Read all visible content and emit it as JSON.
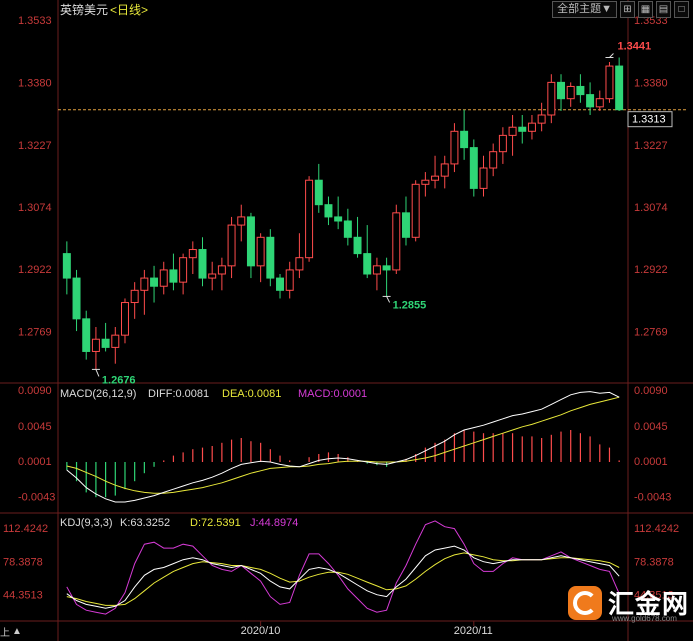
{
  "header": {
    "symbol": "英镑美元",
    "period": "<日线>"
  },
  "toolbar": {
    "theme_label": "全部主题▼",
    "icons": [
      "grid-icon",
      "chart-icon",
      "double-window-icon",
      "single-window-icon"
    ]
  },
  "price_panel": {
    "high_label": "1.3441",
    "low_label": "1.2676",
    "mid_low_label": "1.2855",
    "current_price": "1.3313",
    "price_ticks": [
      "1.3533",
      "1.3380",
      "1.3227",
      "1.3074",
      "1.2922",
      "1.2769"
    ]
  },
  "macd_panel": {
    "title": "MACD(26,12,9)",
    "diff_label": "DIFF:0.0081",
    "dea_label": "DEA:0.0081",
    "macd_label": "MACD:0.0001",
    "ticks": [
      "0.0090",
      "0.0045",
      "0.0001",
      "-0.0043"
    ]
  },
  "kdj_panel": {
    "title": "KDJ(9,3,3)",
    "k_label": "K:63.3252",
    "d_label": "D:72.5391",
    "j_label": "J:44.8974",
    "ticks": [
      "112.4242",
      "78.3878",
      "44.3513"
    ]
  },
  "date_labels": [
    "2020/10",
    "2020/11"
  ],
  "footer": {
    "logo_text": "汇金网",
    "logo_url": "www.gold678.com",
    "pager": "上"
  },
  "colors": {
    "up": "#ff4c4c",
    "down": "#2fd576",
    "axis": "#c83a3a",
    "diff": "#ffffff",
    "dea": "#e8e83a",
    "j_line": "#d63bd6",
    "current_line": "#e0a040"
  },
  "chart_data": {
    "type": "candlestick",
    "price_axis": {
      "min": 1.265,
      "max": 1.3533,
      "ticks": [
        1.3533,
        1.338,
        1.3227,
        1.3074,
        1.2922,
        1.2769
      ]
    },
    "current_price": 1.3313,
    "candles": [
      [
        1.296,
        1.299,
        1.286,
        1.29
      ],
      [
        1.29,
        1.292,
        1.277,
        1.28
      ],
      [
        1.28,
        1.282,
        1.27,
        1.272
      ],
      [
        1.272,
        1.278,
        1.2676,
        1.275
      ],
      [
        1.275,
        1.279,
        1.272,
        1.273
      ],
      [
        1.273,
        1.278,
        1.269,
        1.276
      ],
      [
        1.276,
        1.285,
        1.274,
        1.284
      ],
      [
        1.284,
        1.289,
        1.28,
        1.287
      ],
      [
        1.287,
        1.292,
        1.281,
        1.29
      ],
      [
        1.29,
        1.293,
        1.284,
        1.288
      ],
      [
        1.288,
        1.294,
        1.286,
        1.292
      ],
      [
        1.292,
        1.296,
        1.287,
        1.289
      ],
      [
        1.289,
        1.296,
        1.286,
        1.295
      ],
      [
        1.295,
        1.299,
        1.291,
        1.297
      ],
      [
        1.297,
        1.3,
        1.288,
        1.29
      ],
      [
        1.29,
        1.294,
        1.287,
        1.291
      ],
      [
        1.291,
        1.295,
        1.287,
        1.293
      ],
      [
        1.293,
        1.305,
        1.29,
        1.303
      ],
      [
        1.303,
        1.308,
        1.299,
        1.305
      ],
      [
        1.305,
        1.306,
        1.29,
        1.293
      ],
      [
        1.293,
        1.301,
        1.289,
        1.3
      ],
      [
        1.3,
        1.302,
        1.288,
        1.29
      ],
      [
        1.29,
        1.291,
        1.285,
        1.287
      ],
      [
        1.287,
        1.294,
        1.285,
        1.292
      ],
      [
        1.292,
        1.301,
        1.29,
        1.295
      ],
      [
        1.295,
        1.315,
        1.294,
        1.314
      ],
      [
        1.314,
        1.318,
        1.306,
        1.308
      ],
      [
        1.308,
        1.31,
        1.303,
        1.305
      ],
      [
        1.305,
        1.31,
        1.302,
        1.304
      ],
      [
        1.304,
        1.307,
        1.298,
        1.3
      ],
      [
        1.3,
        1.305,
        1.295,
        1.296
      ],
      [
        1.296,
        1.303,
        1.29,
        1.291
      ],
      [
        1.291,
        1.295,
        1.287,
        1.293
      ],
      [
        1.293,
        1.295,
        1.2855,
        1.292
      ],
      [
        1.292,
        1.308,
        1.291,
        1.306
      ],
      [
        1.306,
        1.31,
        1.298,
        1.3
      ],
      [
        1.3,
        1.314,
        1.299,
        1.313
      ],
      [
        1.313,
        1.316,
        1.31,
        1.314
      ],
      [
        1.314,
        1.32,
        1.312,
        1.315
      ],
      [
        1.315,
        1.32,
        1.312,
        1.318
      ],
      [
        1.318,
        1.328,
        1.316,
        1.326
      ],
      [
        1.326,
        1.3313,
        1.319,
        1.322
      ],
      [
        1.322,
        1.324,
        1.31,
        1.312
      ],
      [
        1.312,
        1.32,
        1.31,
        1.317
      ],
      [
        1.317,
        1.323,
        1.315,
        1.321
      ],
      [
        1.321,
        1.327,
        1.318,
        1.325
      ],
      [
        1.325,
        1.33,
        1.32,
        1.327
      ],
      [
        1.327,
        1.33,
        1.323,
        1.326
      ],
      [
        1.326,
        1.33,
        1.324,
        1.328
      ],
      [
        1.328,
        1.333,
        1.326,
        1.33
      ],
      [
        1.33,
        1.34,
        1.328,
        1.338
      ],
      [
        1.338,
        1.34,
        1.331,
        1.334
      ],
      [
        1.334,
        1.338,
        1.332,
        1.337
      ],
      [
        1.337,
        1.34,
        1.333,
        1.335
      ],
      [
        1.335,
        1.338,
        1.33,
        1.332
      ],
      [
        1.332,
        1.336,
        1.331,
        1.334
      ],
      [
        1.334,
        1.343,
        1.333,
        1.342
      ],
      [
        1.342,
        1.3441,
        1.331,
        1.3313
      ]
    ],
    "macd": {
      "range": [
        -0.006,
        0.0095
      ],
      "ticks": [
        0.009,
        0.0045,
        0.0001,
        -0.0043
      ],
      "diff": [
        -0.001,
        -0.002,
        -0.0032,
        -0.004,
        -0.0046,
        -0.005,
        -0.005,
        -0.0048,
        -0.0045,
        -0.0042,
        -0.0038,
        -0.0034,
        -0.003,
        -0.0026,
        -0.0023,
        -0.0019,
        -0.0014,
        -0.0008,
        -0.0003,
        -0.0001,
        0.0001,
        0.0,
        -0.0003,
        -0.0005,
        -0.0006,
        -0.0002,
        0.0002,
        0.0004,
        0.0005,
        0.0004,
        0.0002,
        0.0,
        -0.0002,
        -0.0003,
        0.0,
        0.0003,
        0.0008,
        0.0014,
        0.002,
        0.0026,
        0.0034,
        0.004,
        0.0043,
        0.0046,
        0.005,
        0.0054,
        0.0058,
        0.006,
        0.0063,
        0.0066,
        0.0072,
        0.0078,
        0.0084,
        0.0087,
        0.0088,
        0.0086,
        0.0087,
        0.0081
      ],
      "dea": [
        -0.0005,
        -0.0008,
        -0.0013,
        -0.0018,
        -0.0024,
        -0.0029,
        -0.0033,
        -0.0036,
        -0.0038,
        -0.0039,
        -0.0039,
        -0.0038,
        -0.0036,
        -0.0034,
        -0.0032,
        -0.0029,
        -0.0026,
        -0.0022,
        -0.0018,
        -0.0014,
        -0.0011,
        -0.0008,
        -0.0007,
        -0.0006,
        -0.0006,
        -0.0005,
        -0.0003,
        -0.0002,
        0.0,
        0.0001,
        0.0001,
        0.0001,
        0.0,
        0.0,
        0.0,
        0.0001,
        0.0003,
        0.0005,
        0.0008,
        0.0012,
        0.0016,
        0.002,
        0.0024,
        0.0028,
        0.0032,
        0.0036,
        0.004,
        0.0044,
        0.0047,
        0.0051,
        0.0055,
        0.0059,
        0.0064,
        0.0068,
        0.0072,
        0.0075,
        0.0078,
        0.0081
      ],
      "hist": [
        -0.001,
        -0.0024,
        -0.0038,
        -0.0044,
        -0.0044,
        -0.0042,
        -0.0034,
        -0.0024,
        -0.0014,
        -0.0006,
        0.0002,
        0.0008,
        0.0012,
        0.0016,
        0.0018,
        0.002,
        0.0024,
        0.0028,
        0.003,
        0.0026,
        0.0024,
        0.0016,
        0.0008,
        0.0002,
        0.0,
        0.0006,
        0.001,
        0.0012,
        0.001,
        0.0006,
        0.0002,
        -0.0002,
        -0.0004,
        -0.0006,
        0.0,
        0.0004,
        0.001,
        0.0018,
        0.0024,
        0.0028,
        0.0036,
        0.004,
        0.0038,
        0.0036,
        0.0036,
        0.0036,
        0.0036,
        0.0032,
        0.0032,
        0.003,
        0.0034,
        0.0038,
        0.004,
        0.0036,
        0.0032,
        0.0022,
        0.0018,
        0.0002
      ]
    },
    "kdj": {
      "range": [
        20,
        125
      ],
      "ticks": [
        112.4242,
        78.3878,
        44.3513
      ],
      "k": [
        45,
        38,
        34,
        32,
        30,
        32,
        38,
        52,
        64,
        70,
        72,
        76,
        80,
        82,
        80,
        76,
        74,
        72,
        74,
        70,
        66,
        58,
        52,
        50,
        60,
        70,
        72,
        70,
        66,
        60,
        54,
        48,
        44,
        42,
        52,
        60,
        72,
        84,
        90,
        92,
        94,
        90,
        82,
        78,
        76,
        78,
        80,
        80,
        80,
        80,
        82,
        84,
        82,
        80,
        78,
        76,
        74,
        63
      ],
      "d": [
        42,
        40,
        37,
        35,
        33,
        33,
        34,
        40,
        48,
        56,
        62,
        68,
        72,
        76,
        78,
        77,
        76,
        74,
        74,
        72,
        70,
        66,
        61,
        57,
        58,
        62,
        65,
        67,
        67,
        65,
        61,
        57,
        53,
        49,
        50,
        53,
        60,
        68,
        75,
        81,
        85,
        87,
        85,
        83,
        80,
        79,
        79,
        80,
        80,
        80,
        81,
        82,
        82,
        81,
        80,
        79,
        77,
        72
      ],
      "j": [
        52,
        34,
        28,
        26,
        24,
        30,
        46,
        76,
        96,
        98,
        92,
        92,
        96,
        94,
        84,
        74,
        70,
        68,
        74,
        66,
        58,
        42,
        34,
        36,
        64,
        86,
        86,
        76,
        64,
        50,
        40,
        30,
        26,
        28,
        56,
        74,
        96,
        116,
        120,
        114,
        112,
        96,
        76,
        68,
        68,
        76,
        82,
        80,
        80,
        80,
        84,
        88,
        82,
        78,
        74,
        70,
        68,
        45
      ]
    },
    "date_ticks": [
      {
        "index": 20,
        "label": "2020/10"
      },
      {
        "index": 42,
        "label": "2020/11"
      }
    ]
  }
}
